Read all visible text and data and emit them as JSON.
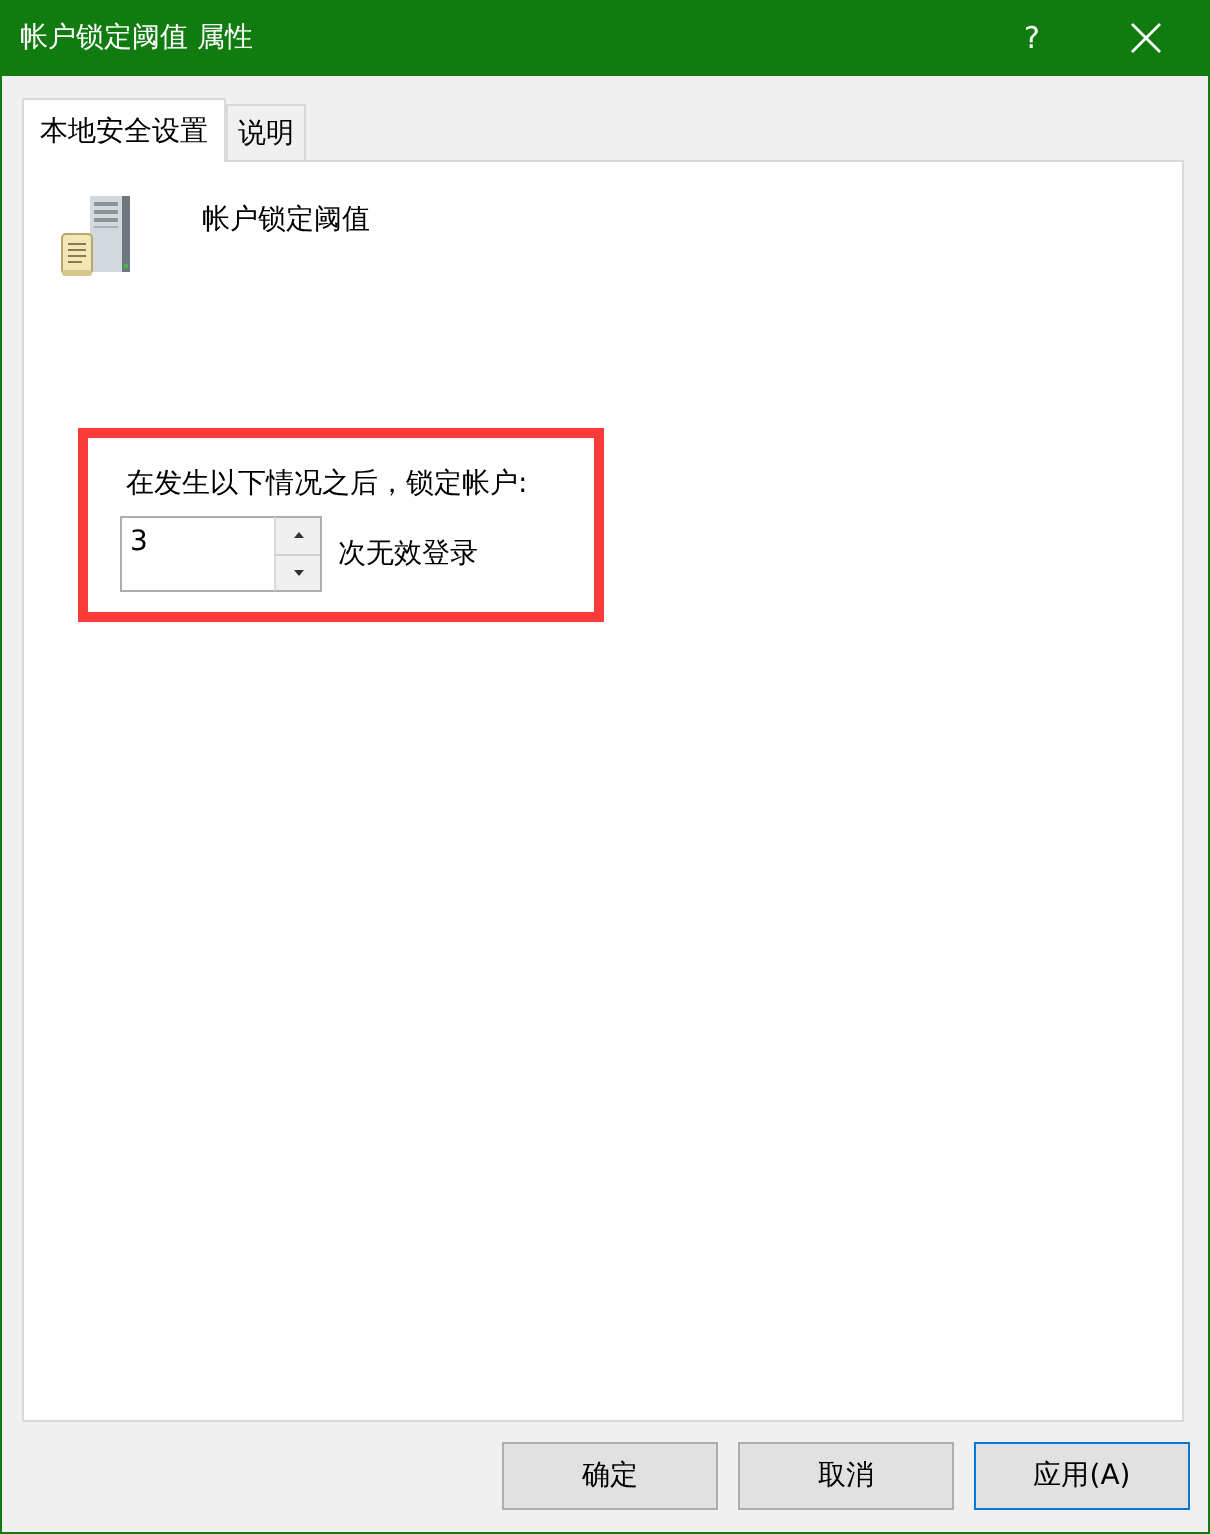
{
  "window": {
    "title": "帐户锁定阈值 属性",
    "help_button": "?"
  },
  "tabs": [
    {
      "label": "本地安全设置",
      "selected": true
    },
    {
      "label": "说明",
      "selected": false
    }
  ],
  "policy": {
    "name": "帐户锁定阈值"
  },
  "lockout": {
    "highlighted": true,
    "prompt": "在发生以下情况之后，锁定帐户:",
    "value": "3",
    "unit": "次无效登录"
  },
  "buttons": [
    {
      "label": "确定",
      "focused": false
    },
    {
      "label": "取消",
      "focused": false
    },
    {
      "label": "应用(A)",
      "focused": true
    }
  ]
}
